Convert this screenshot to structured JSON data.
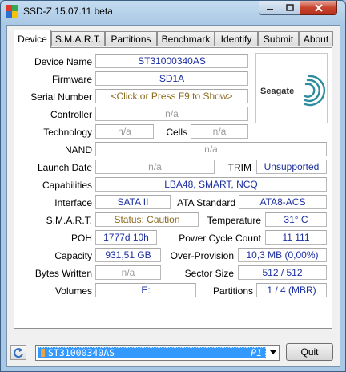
{
  "window": {
    "title": "SSD-Z 15.07.11 beta"
  },
  "tabs": [
    "Device",
    "S.M.A.R.T.",
    "Partitions",
    "Benchmark",
    "Identify",
    "Submit",
    "About"
  ],
  "device": {
    "device_name": {
      "label": "Device Name",
      "value": "ST31000340AS"
    },
    "firmware": {
      "label": "Firmware",
      "value": "SD1A"
    },
    "serial_number": {
      "label": "Serial Number",
      "value": "<Click or Press F9 to Show>"
    },
    "controller": {
      "label": "Controller",
      "value": "n/a"
    },
    "technology": {
      "label": "Technology",
      "value": "n/a"
    },
    "cells": {
      "label": "Cells",
      "value": "n/a"
    },
    "nand": {
      "label": "NAND",
      "value": "n/a"
    },
    "launch_date": {
      "label": "Launch Date",
      "value": "n/a"
    },
    "trim": {
      "label": "TRIM",
      "value": "Unsupported"
    },
    "capabilities": {
      "label": "Capabilities",
      "value": "LBA48, SMART, NCQ"
    },
    "interface": {
      "label": "Interface",
      "value": "SATA II"
    },
    "ata_standard": {
      "label": "ATA Standard",
      "value": "ATA8-ACS"
    },
    "smart": {
      "label": "S.M.A.R.T.",
      "value": "Status: Caution"
    },
    "temperature": {
      "label": "Temperature",
      "value": "31° C"
    },
    "poh": {
      "label": "POH",
      "value": "1777d 10h"
    },
    "power_cycle_count": {
      "label": "Power Cycle Count",
      "value": "11 111"
    },
    "capacity": {
      "label": "Capacity",
      "value": "931,51 GB"
    },
    "over_provision": {
      "label": "Over-Provision",
      "value": "10,3 MB (0,00%)"
    },
    "bytes_written": {
      "label": "Bytes Written",
      "value": "n/a"
    },
    "sector_size": {
      "label": "Sector Size",
      "value": "512 / 512"
    },
    "volumes": {
      "label": "Volumes",
      "value": "E:"
    },
    "partitions": {
      "label": "Partitions",
      "value": "1 / 4 (MBR)"
    }
  },
  "logo": {
    "brand": "Seagate"
  },
  "bottom": {
    "drive_selected": "ST31000340AS",
    "drive_tag": "P1",
    "quit_label": "Quit"
  },
  "colors": {
    "value_blue": "#1c2fa1",
    "value_gray": "#9a9a9a",
    "caution_brown": "#8c6a1e",
    "selection": "#3399ff"
  }
}
